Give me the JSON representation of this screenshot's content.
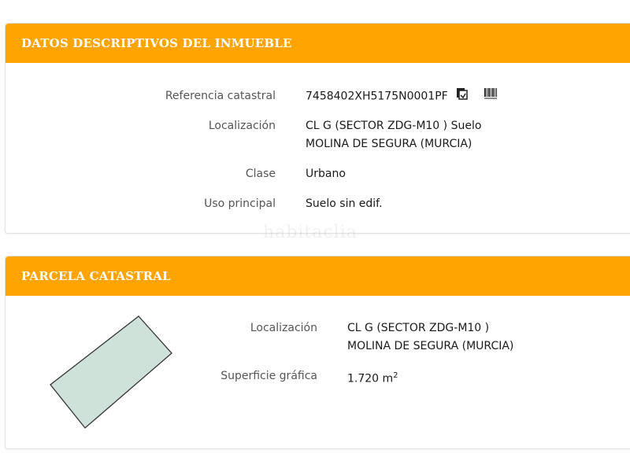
{
  "panel1": {
    "title": "DATOS DESCRIPTIVOS DEL INMUEBLE",
    "rows": [
      {
        "label": "Referencia catastral",
        "value": "7458402XH5175N0001PF"
      },
      {
        "label": "Localización",
        "value_line1": "CL G (SECTOR ZDG-M10 ) Suelo",
        "value_line2": "MOLINA DE SEGURA (MURCIA)"
      },
      {
        "label": "Clase",
        "value": "Urbano"
      },
      {
        "label": "Uso principal",
        "value": "Suelo sin edif."
      }
    ],
    "icons": [
      "copy-document-icon",
      "barcode-icon"
    ]
  },
  "watermark": "habitaclia",
  "panel2": {
    "title": "PARCELA CATASTRAL",
    "rows": [
      {
        "label": "Localización",
        "value_line1": "CL G (SECTOR ZDG-M10 )",
        "value_line2": "MOLINA DE SEGURA (MURCIA)"
      },
      {
        "label": "Superficie gráfica",
        "value": "1.720 m",
        "unit_exp": "2"
      }
    ],
    "parcel_color": "#cfe2da",
    "parcel_stroke": "#333333"
  },
  "colors": {
    "header": "#ffa400",
    "header_text": "#ffffff"
  }
}
